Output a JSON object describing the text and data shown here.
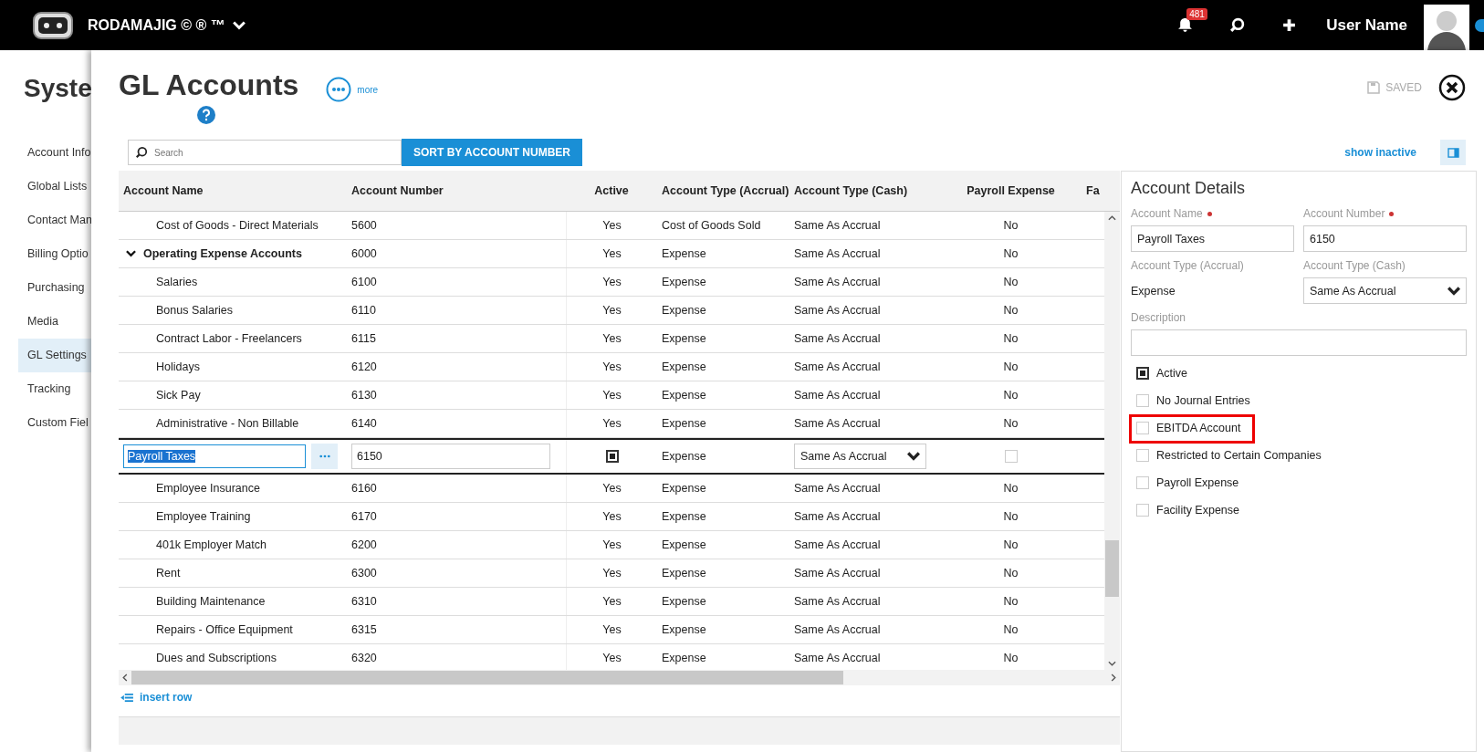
{
  "topbar": {
    "brand": "RODAMAJIG © ® ™",
    "notifications": "481",
    "user_name": "User Name"
  },
  "sidebar": {
    "title": "Syste",
    "items": [
      {
        "label": "Account Info",
        "selected": false
      },
      {
        "label": "Global Lists",
        "selected": false
      },
      {
        "label": "Contact Man",
        "selected": false
      },
      {
        "label": "Billing Optio",
        "selected": false
      },
      {
        "label": "Purchasing",
        "selected": false
      },
      {
        "label": "Media",
        "selected": false
      },
      {
        "label": "GL Settings",
        "selected": true
      },
      {
        "label": "Tracking",
        "selected": false
      },
      {
        "label": "Custom Fiel",
        "selected": false
      }
    ]
  },
  "dialog": {
    "title": "GL Accounts",
    "more": "more",
    "save_status": "SAVED",
    "search": {
      "placeholder": "Search"
    },
    "sort_button": "SORT BY ACCOUNT NUMBER",
    "show_inactive": "show inactive",
    "insert_row": "insert row"
  },
  "table": {
    "columns": [
      "Account Name",
      "Account Number",
      "Active",
      "Account Type (Accrual)",
      "Account Type (Cash)",
      "Payroll Expense",
      "Fa"
    ],
    "rows": [
      {
        "kind": "account",
        "name": "Cost of Goods - Direct Materials",
        "number": "5600",
        "active": "Yes",
        "accrual": "Cost of Goods Sold",
        "cash": "Same As Accrual",
        "payroll": "No"
      },
      {
        "kind": "group",
        "expanded": true,
        "name": "Operating Expense Accounts",
        "number": "6000",
        "active": "Yes",
        "accrual": "Expense",
        "cash": "Same As Accrual",
        "payroll": "No"
      },
      {
        "kind": "account",
        "name": "Salaries",
        "number": "6100",
        "active": "Yes",
        "accrual": "Expense",
        "cash": "Same As Accrual",
        "payroll": "No"
      },
      {
        "kind": "account",
        "name": "Bonus Salaries",
        "number": "6110",
        "active": "Yes",
        "accrual": "Expense",
        "cash": "Same As Accrual",
        "payroll": "No"
      },
      {
        "kind": "account",
        "name": "Contract Labor - Freelancers",
        "number": "6115",
        "active": "Yes",
        "accrual": "Expense",
        "cash": "Same As Accrual",
        "payroll": "No"
      },
      {
        "kind": "account",
        "name": "Holidays",
        "number": "6120",
        "active": "Yes",
        "accrual": "Expense",
        "cash": "Same As Accrual",
        "payroll": "No"
      },
      {
        "kind": "account",
        "name": "Sick Pay",
        "number": "6130",
        "active": "Yes",
        "accrual": "Expense",
        "cash": "Same As Accrual",
        "payroll": "No"
      },
      {
        "kind": "account",
        "name": "Administrative - Non Billable",
        "number": "6140",
        "active": "Yes",
        "accrual": "Expense",
        "cash": "Same As Accrual",
        "payroll": "No"
      },
      {
        "kind": "editing",
        "name": "Payroll Taxes",
        "number": "6150",
        "active_checked": true,
        "accrual": "Expense",
        "cash": "Same As Accrual",
        "payroll_checked": false
      },
      {
        "kind": "account",
        "name": "Employee Insurance",
        "number": "6160",
        "active": "Yes",
        "accrual": "Expense",
        "cash": "Same As Accrual",
        "payroll": "No"
      },
      {
        "kind": "account",
        "name": "Employee Training",
        "number": "6170",
        "active": "Yes",
        "accrual": "Expense",
        "cash": "Same As Accrual",
        "payroll": "No"
      },
      {
        "kind": "account",
        "name": "401k Employer Match",
        "number": "6200",
        "active": "Yes",
        "accrual": "Expense",
        "cash": "Same As Accrual",
        "payroll": "No"
      },
      {
        "kind": "account",
        "name": "Rent",
        "number": "6300",
        "active": "Yes",
        "accrual": "Expense",
        "cash": "Same As Accrual",
        "payroll": "No"
      },
      {
        "kind": "account",
        "name": "Building Maintenance",
        "number": "6310",
        "active": "Yes",
        "accrual": "Expense",
        "cash": "Same As Accrual",
        "payroll": "No"
      },
      {
        "kind": "account",
        "name": "Repairs - Office Equipment",
        "number": "6315",
        "active": "Yes",
        "accrual": "Expense",
        "cash": "Same As Accrual",
        "payroll": "No"
      },
      {
        "kind": "account",
        "name": "Dues and Subscriptions",
        "number": "6320",
        "active": "Yes",
        "accrual": "Expense",
        "cash": "Same As Accrual",
        "payroll": "No"
      }
    ]
  },
  "details": {
    "title": "Account Details",
    "account_name": {
      "label": "Account Name",
      "value": "Payroll Taxes"
    },
    "account_number": {
      "label": "Account Number",
      "value": "6150"
    },
    "accrual": {
      "label": "Account Type (Accrual)",
      "value": "Expense"
    },
    "cash": {
      "label": "Account Type (Cash)",
      "value": "Same As Accrual"
    },
    "description": {
      "label": "Description"
    },
    "checkboxes": [
      {
        "label": "Active",
        "checked": true,
        "highlighted": false
      },
      {
        "label": "No Journal Entries",
        "checked": false,
        "highlighted": false
      },
      {
        "label": "EBITDA Account",
        "checked": false,
        "highlighted": true
      },
      {
        "label": "Restricted to Certain Companies",
        "checked": false,
        "highlighted": false
      },
      {
        "label": "Payroll Expense",
        "checked": false,
        "highlighted": false
      },
      {
        "label": "Facility Expense",
        "checked": false,
        "highlighted": false
      }
    ]
  }
}
